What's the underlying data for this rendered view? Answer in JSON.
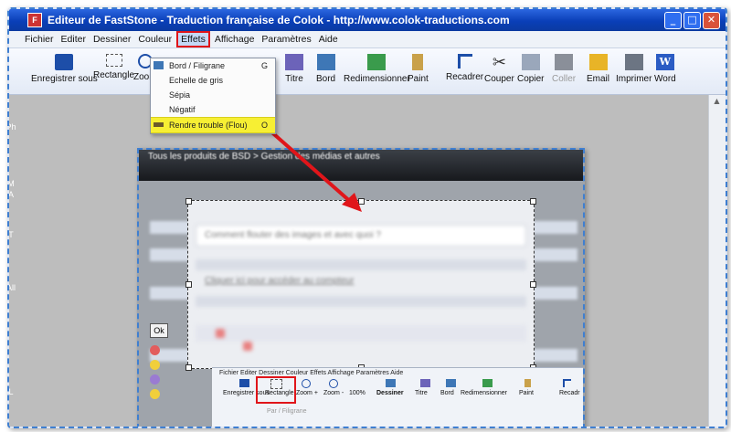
{
  "window": {
    "title": "Editeur de FastStone - Traduction française de Colok - http://www.colok-traductions.com",
    "icon": "faststone-app-icon",
    "buttons": {
      "minimize": "_",
      "maximize": "□",
      "close": "✕"
    }
  },
  "menubar": {
    "items": [
      "Fichier",
      "Editer",
      "Dessiner",
      "Couleur",
      "Effets",
      "Affichage",
      "Paramètres",
      "Aide"
    ],
    "active": "Effets"
  },
  "toolbar": {
    "tools": [
      {
        "label": "Enregistrer sous",
        "icon": "save-disk-icon"
      },
      {
        "label": "Rectangle",
        "icon": "rectangle-select-icon"
      },
      {
        "label": "Zoom",
        "icon": "zoom-in-icon"
      },
      {
        "label": "Titre",
        "icon": "title-icon"
      },
      {
        "label": "Bord",
        "icon": "border-icon"
      },
      {
        "label": "Redimensionner",
        "icon": "resize-icon"
      },
      {
        "label": "Paint",
        "icon": "paint-brush-icon"
      },
      {
        "label": "Recadrer",
        "icon": "crop-icon"
      },
      {
        "label": "Couper",
        "icon": "scissors-icon"
      },
      {
        "label": "Copier",
        "icon": "copy-icon"
      },
      {
        "label": "Coller",
        "icon": "paste-icon"
      },
      {
        "label": "Email",
        "icon": "email-icon"
      },
      {
        "label": "Imprimer",
        "icon": "printer-icon"
      },
      {
        "label": "Word",
        "icon": "word-icon"
      }
    ]
  },
  "effects_menu": {
    "items": [
      {
        "label": "Bord / Filigrane",
        "shortcut": "G"
      },
      {
        "label": "Echelle de gris",
        "shortcut": ""
      },
      {
        "label": "Sépia",
        "shortcut": ""
      },
      {
        "label": "Négatif",
        "shortcut": ""
      },
      {
        "label": "Rendre trouble (Flou)",
        "shortcut": "O"
      }
    ],
    "highlighted": "Rendre trouble (Flou)"
  },
  "left_tabs": [
    "Ph",
    "M",
    "A",
    "T",
    "All",
    "L"
  ],
  "captured_image": {
    "breadcrumb": "Tous les produits de BSD > Gestion des médias et autres",
    "blurred_lines": [
      "Comment flouter des images et avec quoi ?",
      "Cliquer ici pour accéder au compteur"
    ],
    "ok_button": "Ok"
  },
  "mini_editor": {
    "menu": "Fichier  Editer  Dessiner  Couleur  Effets  Affichage  Paramètres  Aide",
    "tools": [
      "Enregistrer sous",
      "Rectangle",
      "Zoom +",
      "Zoom -",
      "100%",
      "Dessiner",
      "Titre",
      "Bord",
      "Redimensionner",
      "Paint",
      "Recadr"
    ],
    "dropdown_hint": "Par / Filigrane"
  },
  "colors": {
    "highlight": "#f7ef33",
    "annotation_red": "#e0151a",
    "titlebar": "#0a3fb8",
    "dash_border": "#3f7fd1"
  }
}
